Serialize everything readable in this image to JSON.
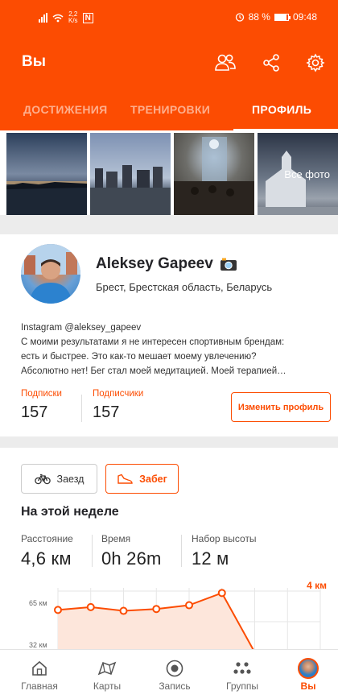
{
  "status_bar": {
    "network_speed": "2,2",
    "network_unit": "K/s",
    "nfc": "N",
    "battery": "88 %",
    "time": "09:48"
  },
  "header": {
    "title": "Вы",
    "icons": [
      "people-icon",
      "share-icon",
      "settings-icon"
    ]
  },
  "tabs": [
    {
      "label": "ДОСТИЖЕНИЯ",
      "active": false
    },
    {
      "label": "ТРЕНИРОВКИ",
      "active": false
    },
    {
      "label": "ПРОФИЛЬ",
      "active": true
    }
  ],
  "photos": {
    "all_label": "Все фото"
  },
  "profile": {
    "name": "Aleksey Gapeev",
    "location": "Брест, Брестская область, Беларусь",
    "bio": [
      "Instagram @aleksey_gapeev",
      "С моими результатами я не интересен спортивным брендам:",
      "есть и быстрее. Это как-то мешает моему увлечению?",
      "Абсолютно нет! Бег  стал моей медитацией. Моей терапией…"
    ],
    "following_label": "Подписки",
    "following_count": "157",
    "followers_label": "Подписчики",
    "followers_count": "157",
    "edit_button": "Изменить профиль"
  },
  "activity": {
    "ride_label": "Заезд",
    "run_label": "Забег",
    "week_title": "На этой неделе",
    "stats": [
      {
        "label": "Расстояние",
        "value": "4,6 км"
      },
      {
        "label": "Время",
        "value": "0h 26m"
      },
      {
        "label": "Набор высоты",
        "value": "12 м"
      }
    ],
    "chart_distance_label": "4 км",
    "chart_y_labels": [
      "65 км",
      "32 км"
    ]
  },
  "chart_data": {
    "type": "line",
    "title": "",
    "xlabel": "",
    "ylabel": "",
    "ylim": [
      0,
      65
    ],
    "series": [
      {
        "values": [
          45,
          48,
          44,
          46,
          50,
          63,
          0
        ]
      }
    ],
    "colors": {
      "line": "#fc4c02",
      "fill": "#fde6db"
    }
  },
  "bottom_nav": [
    {
      "label": "Главная",
      "icon": "home-icon",
      "active": false
    },
    {
      "label": "Карты",
      "icon": "map-icon",
      "active": false
    },
    {
      "label": "Запись",
      "icon": "record-icon",
      "active": false
    },
    {
      "label": "Группы",
      "icon": "groups-icon",
      "active": false
    },
    {
      "label": "Вы",
      "icon": "avatar",
      "active": true
    }
  ],
  "colors": {
    "brand": "#fc4c02",
    "text": "#242428"
  }
}
